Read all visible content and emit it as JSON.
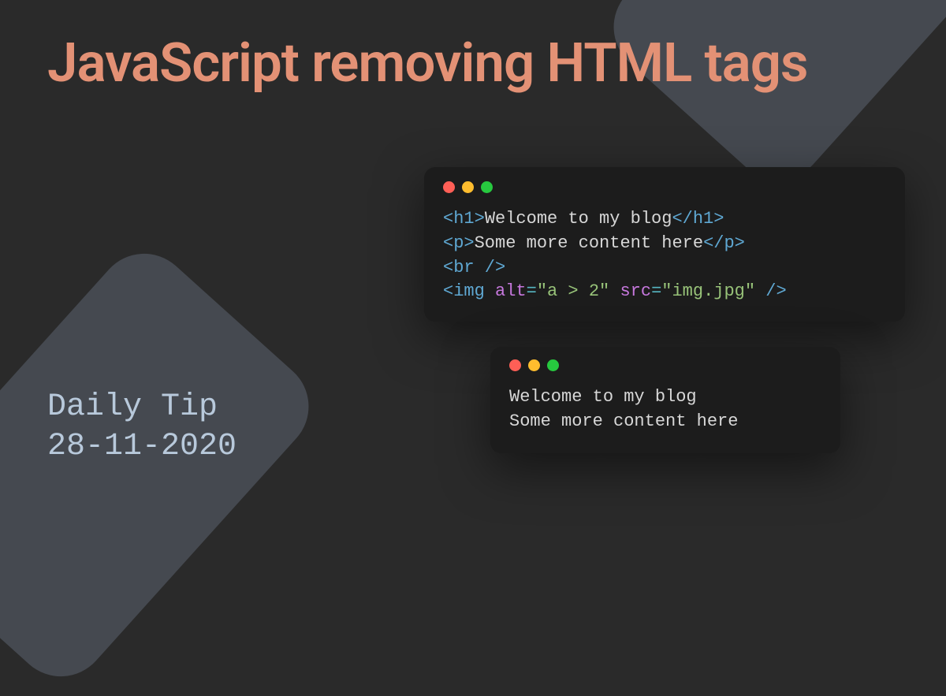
{
  "title": "JavaScript removing HTML tags",
  "subtitle_label": "Daily Tip",
  "subtitle_date": "28-11-2020",
  "code1": {
    "line1": {
      "open": "<h1>",
      "text": "Welcome to my blog",
      "close": "</h1>"
    },
    "line2": {
      "open": "<p>",
      "text": "Some more content here",
      "close": "</p>"
    },
    "line3": {
      "tag": "<br />"
    },
    "line4": {
      "open": "<img ",
      "attr1": "alt",
      "eq1": "=",
      "val1": "\"a > 2\"",
      "space": " ",
      "attr2": "src",
      "eq2": "=",
      "val2": "\"img.jpg\"",
      "close": " />"
    }
  },
  "code2": {
    "line1": "Welcome to my blog",
    "line2": "Some more content here"
  }
}
